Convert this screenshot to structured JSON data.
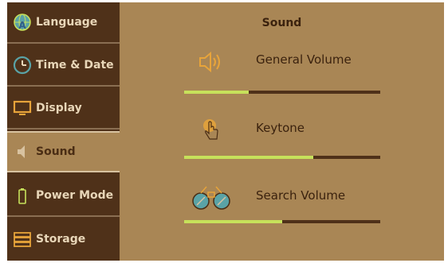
{
  "sidebar": {
    "items": [
      {
        "label": "Language",
        "icon": "globe-icon",
        "active": false
      },
      {
        "label": "Time & Date",
        "icon": "clock-icon",
        "active": false
      },
      {
        "label": "Display",
        "icon": "monitor-icon",
        "active": false
      },
      {
        "label": "Sound",
        "icon": "speaker-icon",
        "active": true
      },
      {
        "label": "Power Mode",
        "icon": "battery-icon",
        "active": false
      },
      {
        "label": "Storage",
        "icon": "storage-icon",
        "active": false
      }
    ]
  },
  "main": {
    "title": "Sound",
    "settings": [
      {
        "label": "General Volume",
        "icon": "speaker-volume-icon",
        "level": 0.33
      },
      {
        "label": "Keytone",
        "icon": "touch-hand-icon",
        "level": 0.66
      },
      {
        "label": "Search Volume",
        "icon": "binoculars-icon",
        "level": 0.5
      }
    ]
  },
  "colors": {
    "sidebar_bg": "#4f3119",
    "panel_bg": "#a98655",
    "slider_fill": "#c7e15b",
    "slider_track": "#4f3119",
    "icon_orange": "#e8a43a",
    "icon_teal": "#5aa3a6"
  }
}
